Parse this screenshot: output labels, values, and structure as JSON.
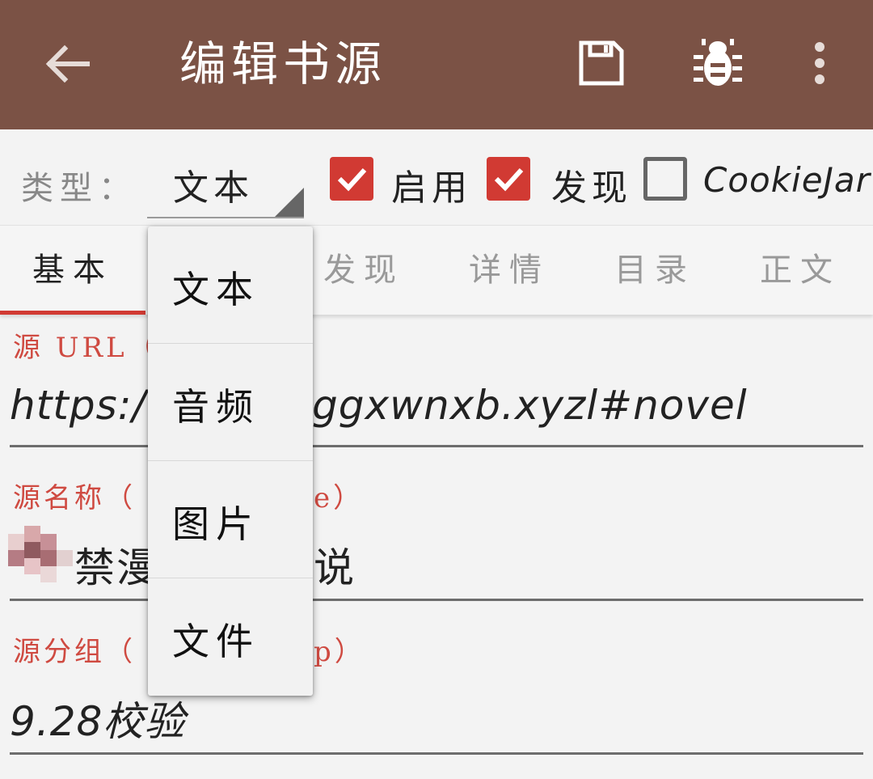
{
  "appbar": {
    "title": "编辑书源",
    "background": "#7b5245",
    "icons": [
      "arrow-back-icon",
      "save-icon",
      "bug-icon",
      "more-vert-icon"
    ]
  },
  "type_row": {
    "label": "类型：",
    "selected": "文本",
    "checkboxes": [
      {
        "label": "启用",
        "checked": true
      },
      {
        "label": "发现",
        "checked": true
      },
      {
        "label": "CookieJar",
        "checked": false
      }
    ],
    "accent": "#d13a33"
  },
  "tabs": [
    {
      "label": "基本",
      "active": true
    },
    {
      "label": "发现",
      "active": false
    },
    {
      "label": "详情",
      "active": false
    },
    {
      "label": "目录",
      "active": false
    },
    {
      "label": "正文",
      "active": false
    }
  ],
  "fields": [
    {
      "label": "源 URL（",
      "value": "https:/",
      "value_tail": "ggxwnxb.xyzl#novel"
    },
    {
      "label": "源名称（",
      "label_tail": "e）",
      "value": "禁漫",
      "value_tail": "说"
    },
    {
      "label": "源分组（",
      "label_tail": "p）",
      "value": "9.28校验"
    }
  ],
  "dropdown": {
    "options": [
      "文本",
      "音频",
      "图片",
      "文件"
    ]
  }
}
